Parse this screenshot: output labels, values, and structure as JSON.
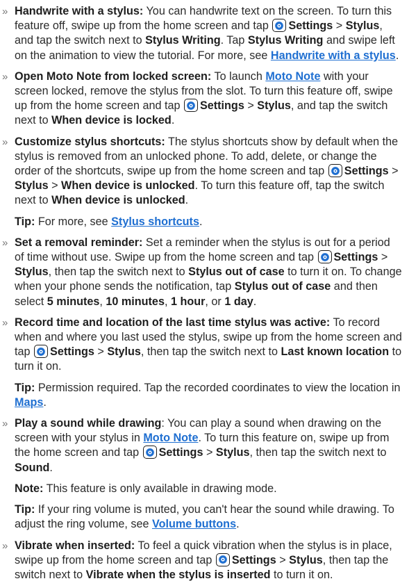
{
  "icon": {
    "name": "settings-icon",
    "accent": "#1f6fd1"
  },
  "link_color": "#1f6fd1",
  "b1": {
    "title": "Handwrite with a stylus:",
    "t1": " You can handwrite text on the screen. To turn this feature off, swipe up from the home screen and tap ",
    "settings": "Settings",
    "t2": " > ",
    "stylus": "Stylus",
    "t3": ", and tap the switch next to ",
    "bold1": "Stylus Writing",
    "t4": ". Tap ",
    "bold2": "Stylus Writing",
    "t5": " and swipe left on the animation to view the tutorial. For more, see ",
    "link": "Handwrite with a stylus",
    "t6": "."
  },
  "b2": {
    "title": "Open Moto Note from locked screen:",
    "t1": " To launch ",
    "link": "Moto Note",
    "t2": " with your screen locked, remove the stylus from the slot. To turn this feature off, swipe up from the home screen and tap ",
    "settings": "Settings",
    "t3": " > ",
    "stylus": "Stylus",
    "t4": ", and tap the switch next to ",
    "bold1": "When device is locked",
    "t5": "."
  },
  "b3": {
    "title": "Customize stylus shortcuts:",
    "t1": " The stylus shortcuts show by default when the stylus is removed from an unlocked phone. To add, delete, or change the order of the shortcuts, swipe up from the home screen and tap ",
    "settings": "Settings",
    "t2": " > ",
    "stylus": "Stylus",
    "t3": " > ",
    "bold1": "When device is unlocked",
    "t4": ". To turn this feature off, tap the switch next to ",
    "bold2": "When device is unlocked",
    "t5": "."
  },
  "tip1": {
    "label": "Tip:",
    "t1": " For more, see ",
    "link": "Stylus shortcuts",
    "t2": "."
  },
  "b4": {
    "title": "Set a removal reminder:",
    "t1": " Set a reminder when the stylus is out for a period of time without use. Swipe up from the home screen and tap ",
    "settings": "Settings",
    "t2": " > ",
    "stylus": "Stylus",
    "t3": ", then tap the switch next to ",
    "bold1": "Stylus out of case",
    "t4": " to turn it on. To change when your phone sends the notification, tap ",
    "bold2": "Stylus out of case",
    "t5": " and then select ",
    "opt1": "5 minutes",
    "sep1": ", ",
    "opt2": "10 minutes",
    "sep2": ", ",
    "opt3": "1 hour",
    "sep3": ", or ",
    "opt4": "1 day",
    "t6": "."
  },
  "b5": {
    "title": "Record time and location of the last time stylus was active:",
    "t1": " To record when and where you last used the stylus, swipe up from the home screen and tap ",
    "settings": "Settings",
    "t2": " > ",
    "stylus": "Stylus",
    "t3": ", then tap the switch next to ",
    "bold1": "Last known location",
    "t4": " to turn it on."
  },
  "tip2": {
    "label": "Tip:",
    "t1": " Permission required. Tap the recorded coordinates to view the location in ",
    "link": "Maps",
    "t2": "."
  },
  "b6": {
    "title": "Play a sound while drawing",
    "t1": ": You can play a sound when drawing on the screen with your stylus in ",
    "link": "Moto Note",
    "t2": ". To turn this feature on, swipe up from the home screen and tap ",
    "settings": "Settings",
    "t3": " > ",
    "stylus": "Stylus",
    "t4": ", then tap the switch next to ",
    "bold1": "Sound",
    "t5": "."
  },
  "note1": {
    "label": "Note:",
    "t1": " This feature is only available in drawing mode."
  },
  "tip3": {
    "label": "Tip:",
    "t1": " If your ring volume is muted, you can't hear the sound while drawing. To adjust the ring volume, see ",
    "link": "Volume buttons",
    "t2": "."
  },
  "b7": {
    "title": "Vibrate when inserted:",
    "t1": " To feel a quick vibration when the stylus is in place, swipe up from the home screen and tap ",
    "settings": "Settings",
    "t2": " > ",
    "stylus": "Stylus",
    "t3": ", then tap the switch next to ",
    "bold1": "Vibrate when the stylus is inserted",
    "t4": " to turn it on."
  }
}
